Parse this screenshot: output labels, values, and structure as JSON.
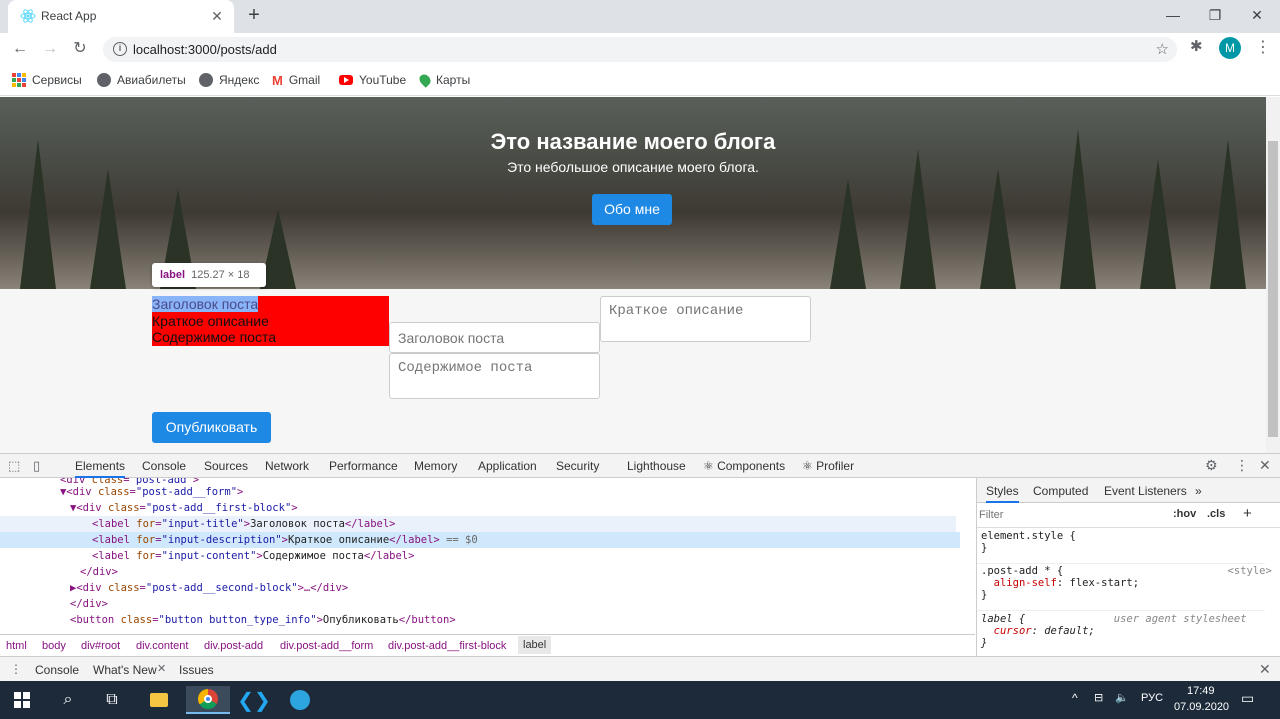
{
  "browser": {
    "tab_title": "React App",
    "new_tab": "+",
    "url": "localhost:3000/posts/add",
    "profile_initial": "M",
    "bookmarks": [
      "Сервисы",
      "Авиабилеты",
      "Яндекс",
      "Gmail",
      "YouTube",
      "Карты"
    ]
  },
  "hero": {
    "title": "Это название моего блога",
    "subtitle": "Это небольшое описание моего блога.",
    "about_button": "Обо мне"
  },
  "inspector_tooltip": {
    "tag": "label",
    "size": "125.27 × 18"
  },
  "form": {
    "labels": [
      "Заголовок поста",
      "Краткое описание",
      "Содержимое поста"
    ],
    "title_placeholder": "Заголовок поста",
    "content_placeholder": "Содержимое поста",
    "description_placeholder": "Краткое описание",
    "publish_button": "Опубликовать"
  },
  "devtools": {
    "tabs": [
      "Elements",
      "Console",
      "Sources",
      "Network",
      "Performance",
      "Memory",
      "Application",
      "Security",
      "Lighthouse",
      "⚛ Components",
      "⚛ Profiler"
    ],
    "breadcrumbs": [
      "html",
      "body",
      "div#root",
      "div.content",
      "div.post-add",
      "div.post-add__form",
      "div.post-add__first-block",
      "label"
    ],
    "styles_tabs": [
      "Styles",
      "Computed",
      "Event Listeners",
      "»"
    ],
    "filter_placeholder": "Filter",
    "hov": ":hov",
    "cls": ".cls",
    "drawer_tabs": [
      "Console",
      "What's New",
      "Issues"
    ]
  },
  "taskbar": {
    "lang": "РУС",
    "time": "17:49",
    "date": "07.09.2020"
  }
}
